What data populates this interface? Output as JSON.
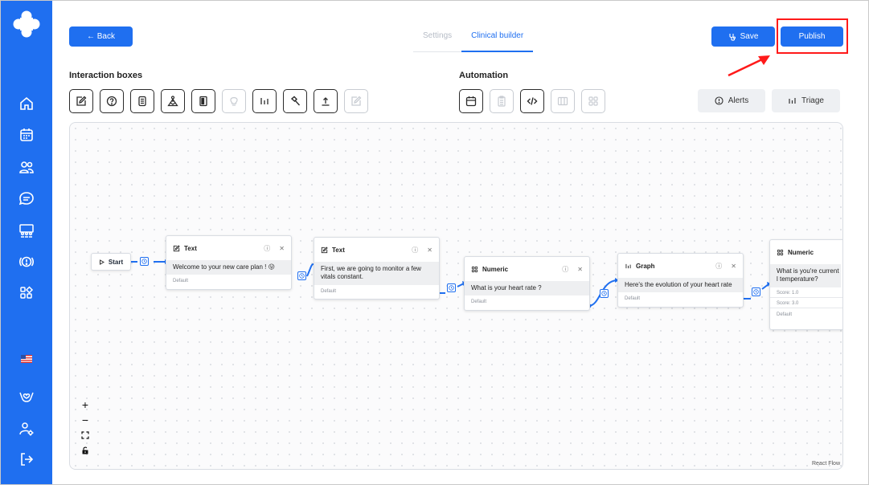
{
  "header": {
    "back_label": "← Back",
    "tabs": [
      {
        "label": "Settings",
        "active": false
      },
      {
        "label": "Clinical builder",
        "active": true
      }
    ],
    "save_label": "Save",
    "publish_label": "Publish"
  },
  "sections": {
    "interaction_title": "Interaction boxes",
    "automation_title": "Automation"
  },
  "interaction_tools": [
    {
      "icon": "edit-icon",
      "enabled": true
    },
    {
      "icon": "question-icon",
      "enabled": true
    },
    {
      "icon": "document-icon",
      "enabled": true
    },
    {
      "icon": "meditation-icon",
      "enabled": true
    },
    {
      "icon": "book-icon",
      "enabled": true
    },
    {
      "icon": "lightbulb-icon",
      "enabled": false
    },
    {
      "icon": "chart-icon",
      "enabled": true
    },
    {
      "icon": "hammer-icon",
      "enabled": true
    },
    {
      "icon": "upload-icon",
      "enabled": true
    },
    {
      "icon": "edit-icon",
      "enabled": false
    }
  ],
  "automation_tools": [
    {
      "icon": "calendar-icon",
      "enabled": true
    },
    {
      "icon": "clipboard-icon",
      "enabled": false
    },
    {
      "icon": "code-icon",
      "enabled": true
    },
    {
      "icon": "columns-icon",
      "enabled": false
    },
    {
      "icon": "grid-icon",
      "enabled": false
    }
  ],
  "side_buttons": {
    "alerts_label": "Alerts",
    "triage_label": "Triage"
  },
  "flow": {
    "start_label": "Start",
    "nodes": [
      {
        "type": "Text",
        "icon": "edit-icon",
        "body": "Welcome to your new care plan ! 😛",
        "footer": "Default"
      },
      {
        "type": "Text",
        "icon": "edit-icon",
        "body": "First, we are going to monitor a few vitals constant.",
        "footer": "Default"
      },
      {
        "type": "Numeric",
        "icon": "grid-icon",
        "body": "What is your heart rate ?",
        "footer": "Default"
      },
      {
        "type": "Graph",
        "icon": "chart-icon",
        "body": "Here's the evolution of your heart rate",
        "footer": "Default"
      },
      {
        "type": "Numeric",
        "icon": "grid-icon",
        "body": "What is you're current l temperature?",
        "scores": [
          "Score: 1.0",
          "Score: 3.0"
        ],
        "footer": "Default"
      }
    ],
    "attribution": "React Flow"
  },
  "colors": {
    "brand": "#1f6ff0",
    "annotation": "#ff1a1a"
  }
}
